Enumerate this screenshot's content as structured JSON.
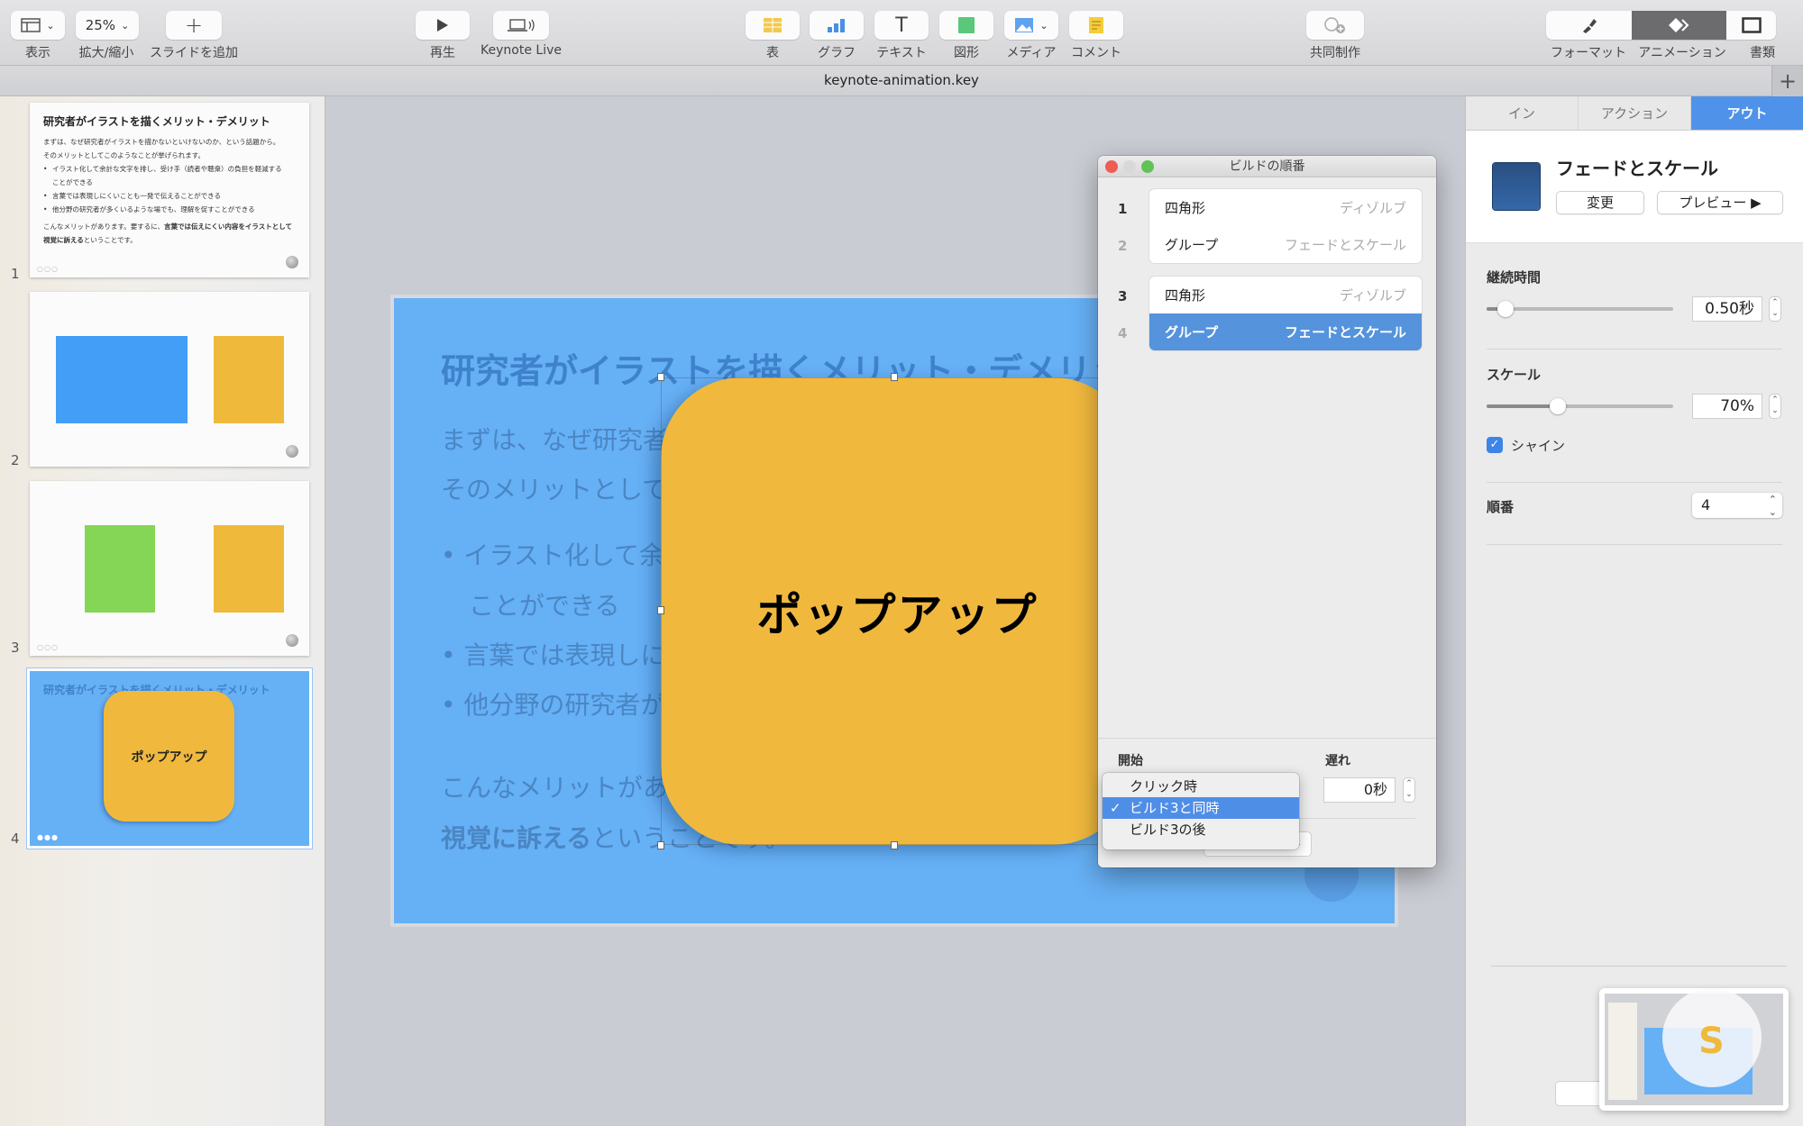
{
  "toolbar": {
    "left": [
      {
        "label": "表示",
        "icon": "view-icon"
      },
      {
        "label": "拡大/縮小",
        "value": "25%"
      },
      {
        "label": "スライドを追加",
        "icon": "plus-icon"
      }
    ],
    "play": {
      "label": "再生",
      "icon": "play-icon"
    },
    "keynote_live": {
      "label": "Keynote Live",
      "icon": "keynote-live-icon"
    },
    "insert": [
      {
        "label": "表",
        "icon": "table-icon"
      },
      {
        "label": "グラフ",
        "icon": "chart-icon"
      },
      {
        "label": "テキスト",
        "icon": "text-icon",
        "glyph": "T"
      },
      {
        "label": "図形",
        "icon": "shape-icon"
      },
      {
        "label": "メディア",
        "icon": "media-icon"
      },
      {
        "label": "コメント",
        "icon": "comment-icon"
      }
    ],
    "collaborate": {
      "label": "共同制作",
      "icon": "collaborate-icon"
    },
    "inspector": [
      {
        "label": "フォーマット",
        "icon": "format-brush-icon"
      },
      {
        "label": "アニメーション",
        "icon": "animation-icon",
        "active": true
      },
      {
        "label": "書類",
        "icon": "document-icon"
      }
    ]
  },
  "document": {
    "title": "keynote-animation.key",
    "add_tab": "+"
  },
  "slides": [
    {
      "number": "1",
      "title": "研究者がイラストを描くメリット・デメリット",
      "intro": [
        "まずは、なぜ研究者がイラストを描かないといけないのか、という話題から。",
        "そのメリットとしてこのようなことが挙げられます。"
      ],
      "bullets": [
        "イラスト化して余計な文字を排し、受け手（読者や聴衆）の負担を軽減する",
        "ことができる",
        "言葉では表現しにくいことも一発で伝えることができる",
        "他分野の研究者が多くいるような場でも、理解を促すことができる"
      ],
      "outro": "こんなメリットがあります。要するに、",
      "outro_bold": "言葉では伝えにくい内容をイラストとして",
      "outro2_bold": "視覚に訴える",
      "outro2": "ということです。",
      "dots": "○○○"
    },
    {
      "number": "2",
      "shapes": [
        "#429ef7",
        "#efb93c"
      ]
    },
    {
      "number": "3",
      "shapes": [
        "#85d557",
        "#efb93c"
      ],
      "dots": "○○○"
    },
    {
      "number": "4",
      "title": "研究者がイラストを描くメリット・デメリット",
      "popup": "ポップアップ",
      "dots": "●●●",
      "selected": true
    }
  ],
  "canvas": {
    "title": "研究者がイラストを描くメリット・デメリット",
    "line1": "まずは、なぜ研究者がイラストを描かないといけないのか、という話題から。",
    "line2": "そのメリットとしてこのようなことが挙げられます。",
    "bullet1": "イラスト化して余計な文字を排し、受け手（読者や聴衆）の負担を軽減する",
    "bullet1b": "ことができる",
    "bullet2": "言葉では表現しにくいことも一発で伝えることができる",
    "bullet3": "他分野の研究者が多くいるような場でも、理解を促すことができる",
    "line3": "こんなメリットがあります。要するに、言葉では伝えにくい内容をイラストとして",
    "line4_bold": "視覚に訴える",
    "line4": "ということです。",
    "popup_label": "ポップアップ",
    "slide_bg": "#66b0f5",
    "popup_color": "#f0b93e"
  },
  "build_order": {
    "title": "ビルドの順番",
    "groups": [
      [
        {
          "num": "1",
          "object": "四角形",
          "effect": "ディゾルブ"
        },
        {
          "num": "2",
          "object": "グループ",
          "effect": "フェードとスケール"
        }
      ],
      [
        {
          "num": "3",
          "object": "四角形",
          "effect": "ディゾルブ"
        },
        {
          "num": "4",
          "object": "グループ",
          "effect": "フェードとスケール",
          "selected": true
        }
      ]
    ],
    "start_label": "開始",
    "delay_label": "遅れ",
    "delay_value": "0秒",
    "start_menu": [
      {
        "label": "クリック時",
        "checked": false
      },
      {
        "label": "ビルド3と同時",
        "checked": true
      },
      {
        "label": "ビルド3の後",
        "checked": false
      }
    ],
    "check_mark": "✓",
    "preview_arrow": "▶"
  },
  "inspector": {
    "tabs": [
      {
        "label": "イン",
        "active": false
      },
      {
        "label": "アクション",
        "active": false
      },
      {
        "label": "アウト",
        "active": true
      }
    ],
    "effect_name": "フェードとスケール",
    "change_label": "変更",
    "preview_label": "プレビュー ▶",
    "duration_label": "継続時間",
    "duration_value": "0.50秒",
    "duration_fraction": 0.1,
    "scale_label": "スケール",
    "scale_value": "70%",
    "scale_fraction": 0.38,
    "shine_label": "シャイン",
    "shine_checked": true,
    "order_label": "順番",
    "order_value": "4"
  }
}
